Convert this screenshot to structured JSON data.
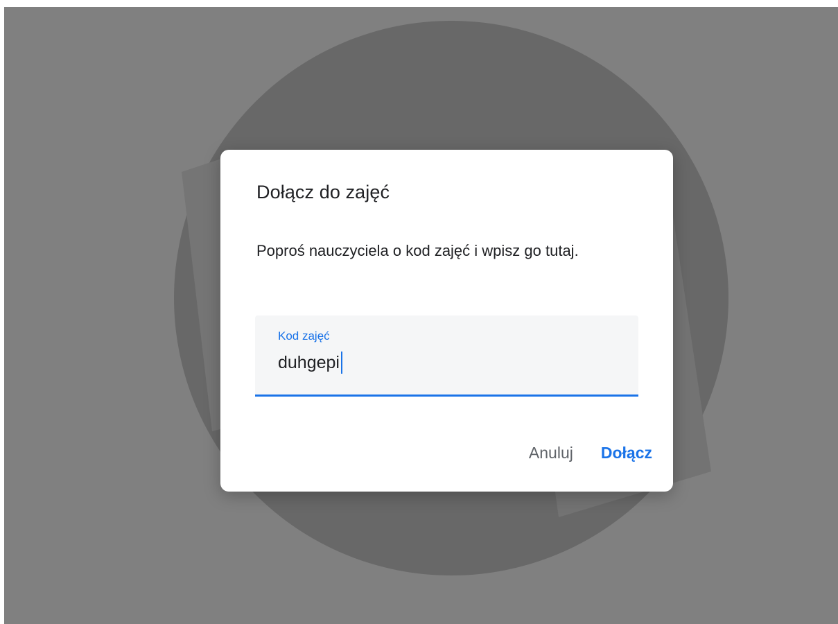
{
  "dialog": {
    "title": "Dołącz do zajęć",
    "description": "Poproś nauczyciela o kod zajęć i wpisz go tutaj.",
    "field": {
      "label": "Kod zajęć",
      "value": "duhgepi"
    },
    "buttons": {
      "cancel": "Anuluj",
      "join": "Dołącz"
    }
  },
  "colors": {
    "accent": "#1a73e8",
    "overlay": "#808080",
    "dialog_bg": "#ffffff",
    "field_bg": "#f5f6f7",
    "text_primary": "#202124",
    "text_secondary": "#5f6368"
  }
}
